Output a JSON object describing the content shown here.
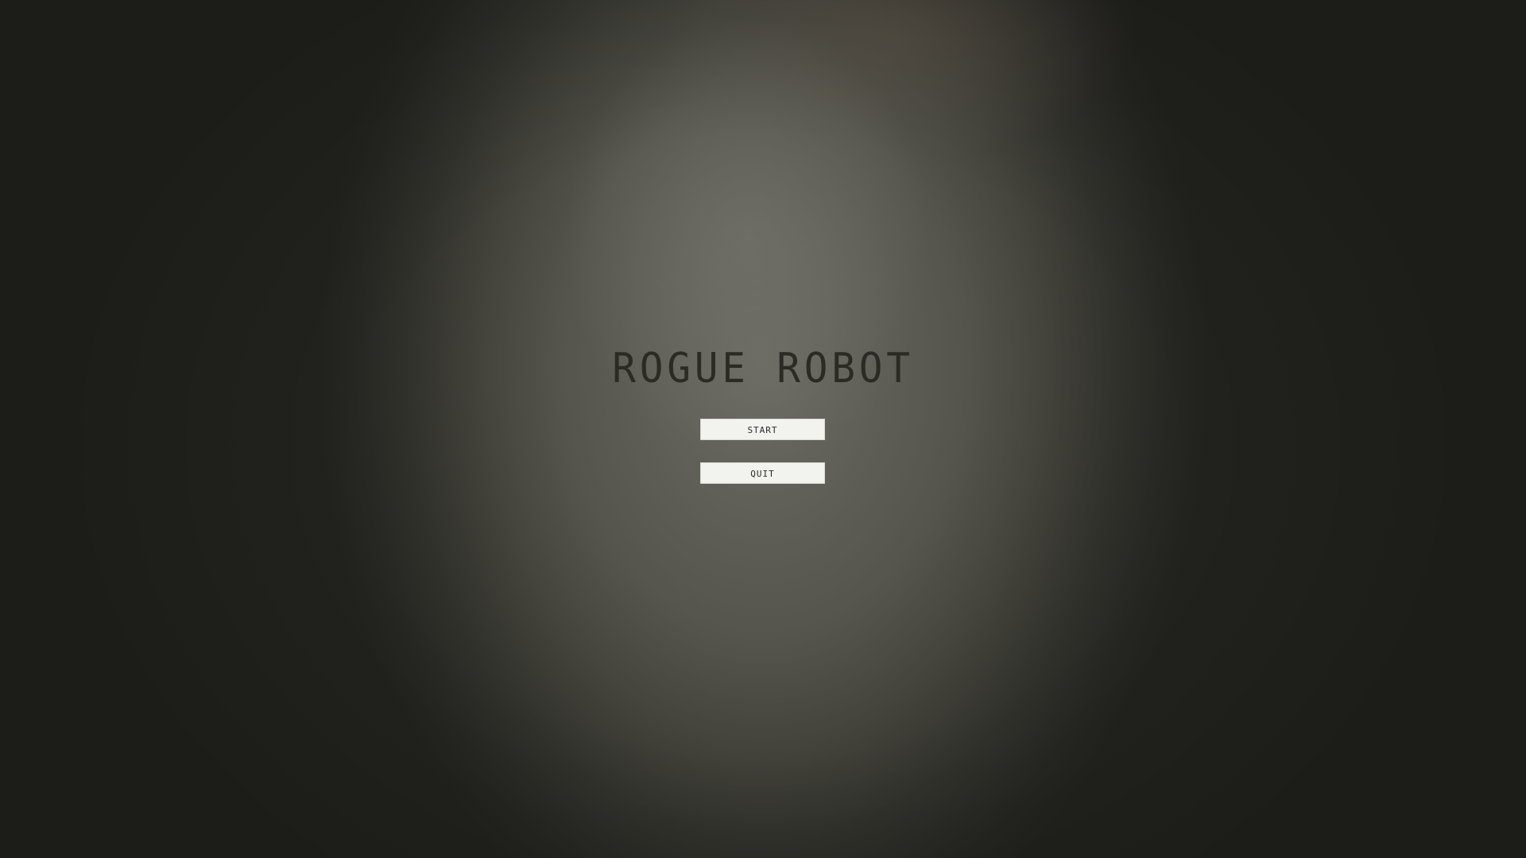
{
  "game": {
    "title": "ROGUE ROBOT"
  },
  "main_menu": {
    "start_label": "START",
    "quit_label": "QUIT"
  },
  "colors": {
    "title_text": "#2b2b26",
    "button_background": "#f2f2ef",
    "button_text": "#2a2a2a",
    "background_center": "#6a6a62",
    "background_edge": "#22221e"
  }
}
